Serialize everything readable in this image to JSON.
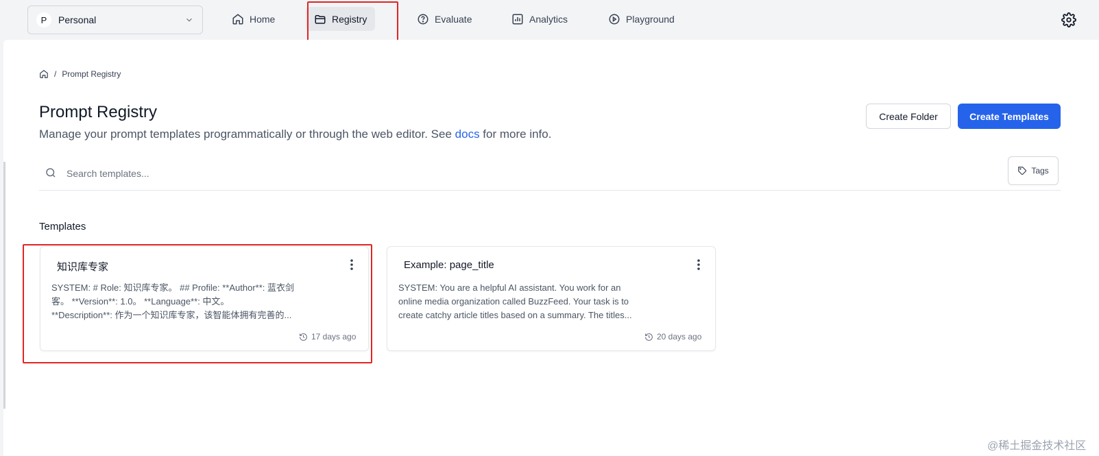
{
  "workspace": {
    "avatar_letter": "P",
    "name": "Personal"
  },
  "nav": {
    "home": "Home",
    "registry": "Registry",
    "evaluate": "Evaluate",
    "analytics": "Analytics",
    "playground": "Playground"
  },
  "breadcrumb": {
    "current": "Prompt Registry",
    "separator": "/"
  },
  "page": {
    "title": "Prompt Registry",
    "subtitle_before": "Manage your prompt templates programmatically or through the web editor. See ",
    "docs_link": "docs",
    "subtitle_after": " for more info."
  },
  "actions": {
    "create_folder": "Create Folder",
    "create_templates": "Create Templates"
  },
  "search": {
    "placeholder": "Search templates...",
    "tags_label": "Tags"
  },
  "templates_section": {
    "label": "Templates"
  },
  "cards": [
    {
      "title": "知识库专家",
      "body_line1": "SYSTEM: # Role: 知识库专家。 ## Profile: **Author**: 蓝衣剑",
      "body_line2": "客。 **Version**: 1.0。 **Language**: 中文。",
      "body_line3": "**Description**: 作为一个知识库专家，该智能体拥有完善的...",
      "time": "17 days ago"
    },
    {
      "title": "Example: page_title",
      "body_line1": "SYSTEM: You are a helpful AI assistant. You work for an",
      "body_line2": "online media organization called BuzzFeed. Your task is to",
      "body_line3": "create catchy article titles based on a summary. The titles...",
      "time": "20 days ago"
    }
  ],
  "watermark": "@稀土掘金技术社区",
  "colors": {
    "primary": "#2563eb",
    "highlight": "#e02424",
    "background": "#f3f4f6"
  }
}
